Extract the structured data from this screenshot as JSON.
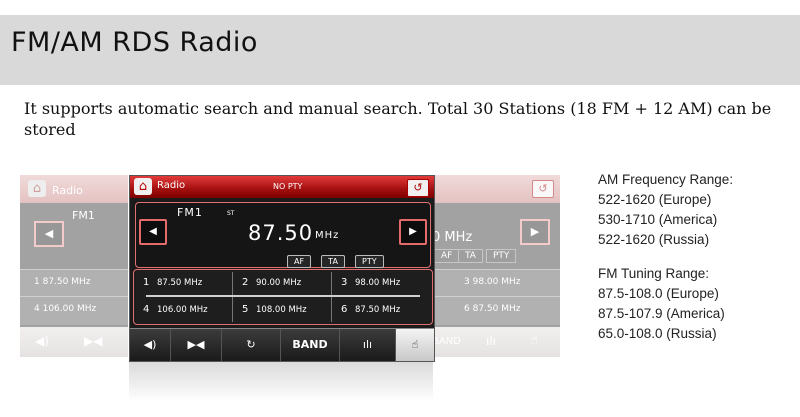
{
  "header": {
    "title": "FM/AM RDS Radio"
  },
  "description": "It supports automatic search and manual search. Total 30 Stations (18 FM + 12 AM) can be stored",
  "am_range": {
    "title": "AM Frequency Range:",
    "items": [
      "522-1620 (Europe)",
      "530-1710 (America)",
      "522-1620 (Russia)"
    ]
  },
  "fm_range": {
    "title": "FM Tuning Range:",
    "items": [
      "87.5-108.0 (Europe)",
      "87.5-107.9 (America)",
      "65.0-108.0 (Russia)"
    ]
  },
  "radio": {
    "title": "Radio",
    "pty_status": "NO PTY",
    "band": "FM1",
    "stereo": "ST",
    "frequency": "87.50",
    "unit": "MHz",
    "chips": [
      "AF",
      "TA",
      "PTY"
    ],
    "presets": [
      {
        "num": "1",
        "freq": "87.50 MHz"
      },
      {
        "num": "2",
        "freq": "90.00 MHz"
      },
      {
        "num": "3",
        "freq": "98.00 MHz"
      },
      {
        "num": "4",
        "freq": "106.00 MHz"
      },
      {
        "num": "5",
        "freq": "108.00 MHz"
      },
      {
        "num": "6",
        "freq": "87.50 MHz"
      }
    ],
    "bottom": {
      "band_label": "BAND"
    }
  },
  "left_panel": {
    "title": "Radio",
    "band": "FM1",
    "preset1": "1  87.50 MHz",
    "preset4": "4  106.00 MHz"
  },
  "right_panel": {
    "unit": "0 MHz",
    "chips": [
      "AF",
      "TA",
      "PTY"
    ],
    "preset3": "3  98.00 MHz",
    "preset6": "6  87.50 MHz",
    "band_label": "BAND"
  },
  "colors": {
    "accent": "#b30f0f",
    "header_bg": "#d9d9d9"
  }
}
